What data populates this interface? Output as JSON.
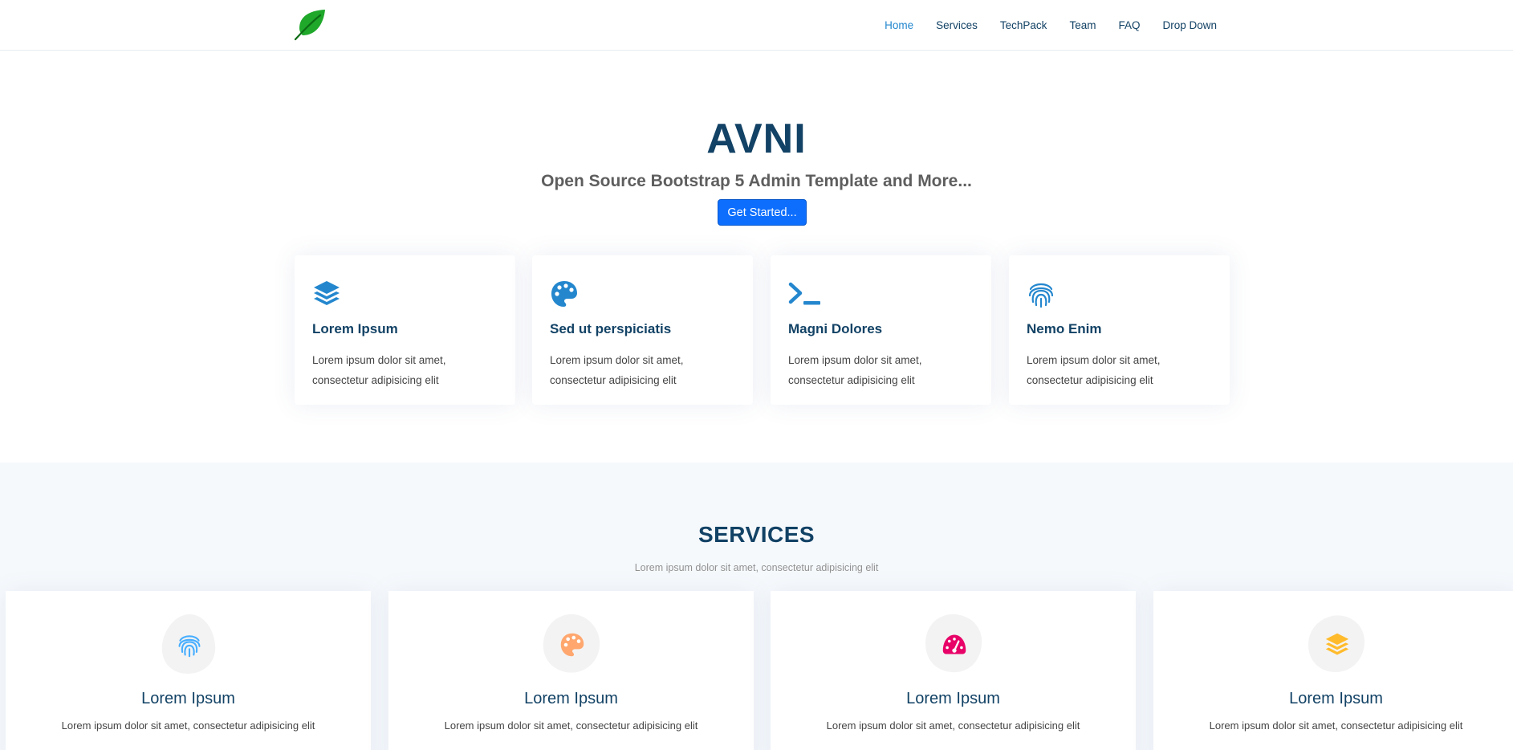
{
  "header": {
    "logo": "leaf-icon",
    "nav": [
      {
        "label": "Home",
        "active": true
      },
      {
        "label": "Services",
        "active": false
      },
      {
        "label": "TechPack",
        "active": false
      },
      {
        "label": "Team",
        "active": false
      },
      {
        "label": "FAQ",
        "active": false
      },
      {
        "label": "Drop Down",
        "active": false
      }
    ]
  },
  "hero": {
    "title": "AVNI",
    "subtitle": "Open Source Bootstrap 5 Admin Template and More...",
    "cta": "Get Started..."
  },
  "boxes": [
    {
      "icon": "layers-icon",
      "title": "Lorem Ipsum",
      "text": "Lorem ipsum dolor sit amet, consectetur adipisicing elit"
    },
    {
      "icon": "palette-icon",
      "title": "Sed ut perspiciatis",
      "text": "Lorem ipsum dolor sit amet, consectetur adipisicing elit"
    },
    {
      "icon": "terminal-icon",
      "title": "Magni Dolores",
      "text": "Lorem ipsum dolor sit amet, consectetur adipisicing elit"
    },
    {
      "icon": "fingerprint-icon",
      "title": "Nemo Enim",
      "text": "Lorem ipsum dolor sit amet, consectetur adipisicing elit"
    }
  ],
  "services": {
    "title": "SERVICES",
    "subtitle": "Lorem ipsum dolor sit amet, consectetur adipisicing elit",
    "items": [
      {
        "icon": "fingerprint-icon",
        "color": "#47aeff",
        "title": "Lorem Ipsum",
        "text": "Lorem ipsum dolor sit amet, consectetur adipisicing elit"
      },
      {
        "icon": "palette-icon",
        "color": "#ffa76e",
        "title": "Lorem Ipsum",
        "text": "Lorem ipsum dolor sit amet, consectetur adipisicing elit"
      },
      {
        "icon": "speedometer-icon",
        "color": "#e80368",
        "title": "Lorem Ipsum",
        "text": "Lorem ipsum dolor sit amet, consectetur adipisicing elit"
      },
      {
        "icon": "layers-icon",
        "color": "#ffbb2c",
        "title": "Lorem Ipsum",
        "text": "Lorem ipsum dolor sit amet, consectetur adipisicing elit"
      }
    ]
  },
  "colors": {
    "primary": "#2487ce",
    "heading": "#124265",
    "button": "#0d6efd",
    "leaf": "#1fa82a"
  }
}
